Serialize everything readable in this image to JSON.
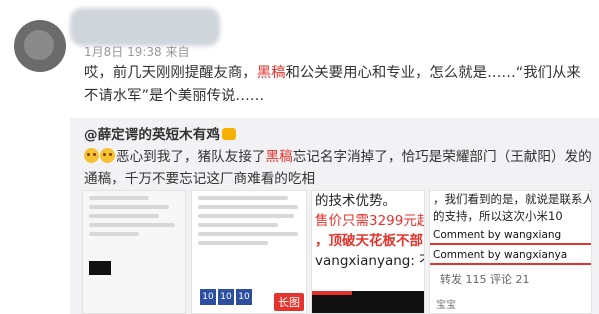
{
  "post": {
    "meta": "1月8日 19:38 来自",
    "text_before": "哎，前几天刚刚提醒友商，",
    "highlight_word": "黑稿",
    "text_after": "和公关要用心和专业，怎么就是……“我们从来不请水军”是个美丽传说……"
  },
  "repost": {
    "author": "@薛定谔的英短木有鸡",
    "text_before": "恶心到我了，猪队友接了",
    "highlight_word": "黑稿",
    "text_after": "忘记名字消掉了，恰巧是荣耀部门（王献阳）发的通稿，千万不要忘记这厂商难看的吃相"
  },
  "thumbnails": {
    "third": {
      "line1": "的技术优势。",
      "line2": "售价只需3299元起",
      "line3": "，顶破天花板不部",
      "line4": "vangxianyang: 不要抄"
    },
    "fourth": {
      "line1": "，我们看到的是，就说是联系人家加上",
      "line2": "的支持，所以这次小米10",
      "comment1": "Comment by wangxiang",
      "comment2": "Comment by wangxianya",
      "stats": "转发 115    评论 21",
      "foot": "宝宝"
    },
    "long_badge": "长图",
    "phone_labels": [
      "10",
      "10",
      "10"
    ]
  },
  "colors": {
    "highlight": "#e4332d",
    "repost_bg": "#f2f2f5",
    "meta": "#999999"
  }
}
